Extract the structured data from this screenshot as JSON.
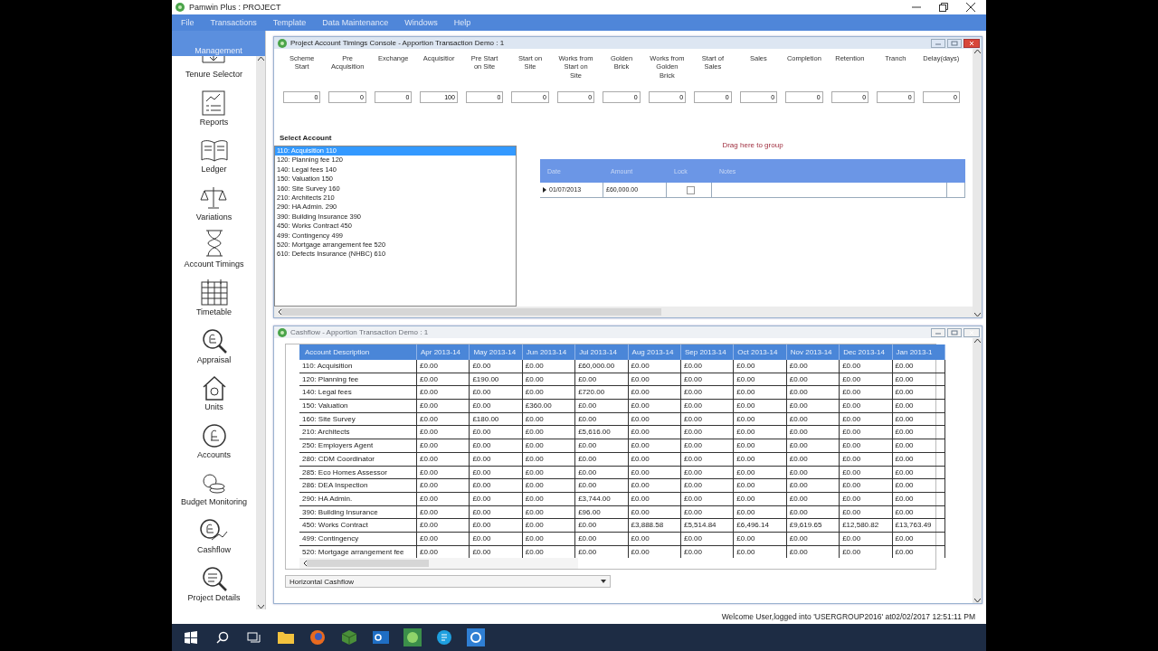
{
  "window": {
    "title": "Pamwin Plus : PROJECT"
  },
  "menu": [
    "File",
    "Transactions",
    "Template",
    "Data Maintenance",
    "Windows",
    "Help"
  ],
  "sidebar": {
    "header": "Management",
    "items": [
      {
        "label": "Tenure Selector"
      },
      {
        "label": "Reports"
      },
      {
        "label": "Ledger"
      },
      {
        "label": "Variations"
      },
      {
        "label": "Account Timings"
      },
      {
        "label": "Timetable"
      },
      {
        "label": "Appraisal"
      },
      {
        "label": "Units"
      },
      {
        "label": "Accounts"
      },
      {
        "label": "Budget Monitoring"
      },
      {
        "label": "Cashflow"
      },
      {
        "label": "Project Details"
      }
    ]
  },
  "timings_window": {
    "title": "Project Account Timings Console - Apportion Transaction Demo : 1",
    "fields": [
      {
        "label": "Scheme\nStart",
        "value": "0"
      },
      {
        "label": "Pre\nAcquisition",
        "value": "0"
      },
      {
        "label": "Exchange",
        "value": "0"
      },
      {
        "label": "Acquisitior",
        "value": "100"
      },
      {
        "label": "Pre Start\non Site",
        "value": "0"
      },
      {
        "label": "Start on\nSite",
        "value": "0"
      },
      {
        "label": "Works from\nStart on\nSite",
        "value": "0"
      },
      {
        "label": "Golden\nBrick",
        "value": "0"
      },
      {
        "label": "Works from\nGolden\nBrick",
        "value": "0"
      },
      {
        "label": "Start of\nSales",
        "value": "0"
      },
      {
        "label": "Sales",
        "value": "0"
      },
      {
        "label": "Completion",
        "value": "0"
      },
      {
        "label": "Retention",
        "value": "0"
      },
      {
        "label": "Tranch",
        "value": "0"
      },
      {
        "label": "Delay(days)",
        "value": "0"
      }
    ],
    "select_account_label": "Select Account",
    "accounts": [
      {
        "label": "110: Acquisition  110",
        "selected": true
      },
      {
        "label": "120: Planning fee  120",
        "selected": false
      },
      {
        "label": "140: Legal fees  140",
        "selected": false
      },
      {
        "label": "150: Valuation  150",
        "selected": false
      },
      {
        "label": "160: Site Survey  160",
        "selected": false
      },
      {
        "label": "210: Architects  210",
        "selected": false
      },
      {
        "label": "290: HA Admin.  290",
        "selected": false
      },
      {
        "label": "390: Building Insurance  390",
        "selected": false
      },
      {
        "label": "450: Works Contract  450",
        "selected": false
      },
      {
        "label": "499: Contingency  499",
        "selected": false
      },
      {
        "label": "520: Mortgage arrangement fee  520",
        "selected": false
      },
      {
        "label": "610: Defects Insurance (NHBC)  610",
        "selected": false
      }
    ],
    "group_hint": "Drag here to group",
    "grid_columns": [
      "Date",
      "Amount",
      "Lock",
      "Notes"
    ],
    "grid_rows": [
      {
        "date": "01/07/2013",
        "amount": "£60,000.00",
        "lock": false,
        "notes": ""
      }
    ]
  },
  "cashflow_window": {
    "title": "Cashflow - Apportion Transaction Demo : 1",
    "columns": [
      "Account Description",
      "Apr 2013-14",
      "May 2013-14",
      "Jun 2013-14",
      "Jul 2013-14",
      "Aug 2013-14",
      "Sep 2013-14",
      "Oct 2013-14",
      "Nov 2013-14",
      "Dec 2013-14",
      "Jan 2013-1"
    ],
    "rows": [
      [
        "110: Acquisition",
        "£0.00",
        "£0.00",
        "£0.00",
        "£60,000.00",
        "£0.00",
        "£0.00",
        "£0.00",
        "£0.00",
        "£0.00",
        "£0.00"
      ],
      [
        "120: Planning fee",
        "£0.00",
        "£190.00",
        "£0.00",
        "£0.00",
        "£0.00",
        "£0.00",
        "£0.00",
        "£0.00",
        "£0.00",
        "£0.00"
      ],
      [
        "140: Legal fees",
        "£0.00",
        "£0.00",
        "£0.00",
        "£720.00",
        "£0.00",
        "£0.00",
        "£0.00",
        "£0.00",
        "£0.00",
        "£0.00"
      ],
      [
        "150: Valuation",
        "£0.00",
        "£0.00",
        "£360.00",
        "£0.00",
        "£0.00",
        "£0.00",
        "£0.00",
        "£0.00",
        "£0.00",
        "£0.00"
      ],
      [
        "160: Site Survey",
        "£0.00",
        "£180.00",
        "£0.00",
        "£0.00",
        "£0.00",
        "£0.00",
        "£0.00",
        "£0.00",
        "£0.00",
        "£0.00"
      ],
      [
        "210: Architects",
        "£0.00",
        "£0.00",
        "£0.00",
        "£5,616.00",
        "£0.00",
        "£0.00",
        "£0.00",
        "£0.00",
        "£0.00",
        "£0.00"
      ],
      [
        "250: Employers Agent",
        "£0.00",
        "£0.00",
        "£0.00",
        "£0.00",
        "£0.00",
        "£0.00",
        "£0.00",
        "£0.00",
        "£0.00",
        "£0.00"
      ],
      [
        "280: CDM Coordinator",
        "£0.00",
        "£0.00",
        "£0.00",
        "£0.00",
        "£0.00",
        "£0.00",
        "£0.00",
        "£0.00",
        "£0.00",
        "£0.00"
      ],
      [
        "285: Eco Homes Assessor",
        "£0.00",
        "£0.00",
        "£0.00",
        "£0.00",
        "£0.00",
        "£0.00",
        "£0.00",
        "£0.00",
        "£0.00",
        "£0.00"
      ],
      [
        "286: DEA Inspection",
        "£0.00",
        "£0.00",
        "£0.00",
        "£0.00",
        "£0.00",
        "£0.00",
        "£0.00",
        "£0.00",
        "£0.00",
        "£0.00"
      ],
      [
        "290: HA Admin.",
        "£0.00",
        "£0.00",
        "£0.00",
        "£3,744.00",
        "£0.00",
        "£0.00",
        "£0.00",
        "£0.00",
        "£0.00",
        "£0.00"
      ],
      [
        "390: Building Insurance",
        "£0.00",
        "£0.00",
        "£0.00",
        "£96.00",
        "£0.00",
        "£0.00",
        "£0.00",
        "£0.00",
        "£0.00",
        "£0.00"
      ],
      [
        "450: Works Contract",
        "£0.00",
        "£0.00",
        "£0.00",
        "£0.00",
        "£3,888.58",
        "£5,514.84",
        "£6,496.14",
        "£9,619.65",
        "£12,580.82",
        "£13,763.49"
      ],
      [
        "499: Contingency",
        "£0.00",
        "£0.00",
        "£0.00",
        "£0.00",
        "£0.00",
        "£0.00",
        "£0.00",
        "£0.00",
        "£0.00",
        "£0.00"
      ],
      [
        "520: Mortgage arrangement fee",
        "£0.00",
        "£0.00",
        "£0.00",
        "£0.00",
        "£0.00",
        "£0.00",
        "£0.00",
        "£0.00",
        "£0.00",
        "£0.00"
      ]
    ],
    "view_select": "Horizontal Cashflow"
  },
  "status_bar": "Welcome User,logged into 'USERGROUP2016' at02/02/2017 12:51:11 PM"
}
